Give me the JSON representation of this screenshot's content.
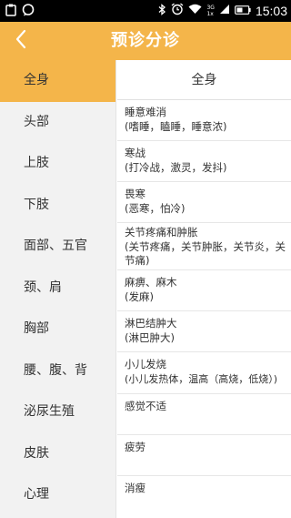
{
  "status_bar": {
    "time": "15:03",
    "network_top": "3G",
    "network_bottom": "1x",
    "icons": [
      "clipboard-icon",
      "chat-bubble-icon",
      "bluetooth-icon",
      "alarm-icon",
      "wifi-icon",
      "signal-icon",
      "battery-icon"
    ]
  },
  "header": {
    "title": "预诊分诊",
    "back_icon": "chevron-left-icon"
  },
  "colors": {
    "accent": "#f4b54a",
    "sidebar_bg": "#f2f2f2"
  },
  "sidebar": {
    "items": [
      {
        "label": "全身",
        "active": true
      },
      {
        "label": "头部"
      },
      {
        "label": "上肢"
      },
      {
        "label": "下肢"
      },
      {
        "label": "面部、五官"
      },
      {
        "label": "颈、肩"
      },
      {
        "label": "胸部"
      },
      {
        "label": "腰、腹、背"
      },
      {
        "label": "泌尿生殖"
      },
      {
        "label": "皮肤"
      },
      {
        "label": "心理"
      }
    ]
  },
  "main": {
    "header": "全身",
    "symptoms": [
      {
        "name": "睡意难消",
        "alias": "(嗜睡，瞌睡，睡意浓)"
      },
      {
        "name": "寒战",
        "alias": "(打冷战，激灵，发抖)"
      },
      {
        "name": "畏寒",
        "alias": "(恶寒，怕冷)"
      },
      {
        "name": "关节疼痛和肿胀",
        "alias": "(关节疼痛，关节肿胀，关节炎，关节痛)"
      },
      {
        "name": "麻痹、麻木",
        "alias": "(发麻)"
      },
      {
        "name": "淋巴结肿大",
        "alias": "(淋巴肿大)"
      },
      {
        "name": "小儿发烧",
        "alias": "(小儿发热体，温高（高烧，低烧）)"
      },
      {
        "name": "感觉不适",
        "alias": ""
      },
      {
        "name": "疲劳",
        "alias": ""
      },
      {
        "name": "消瘦",
        "alias": ""
      }
    ]
  }
}
